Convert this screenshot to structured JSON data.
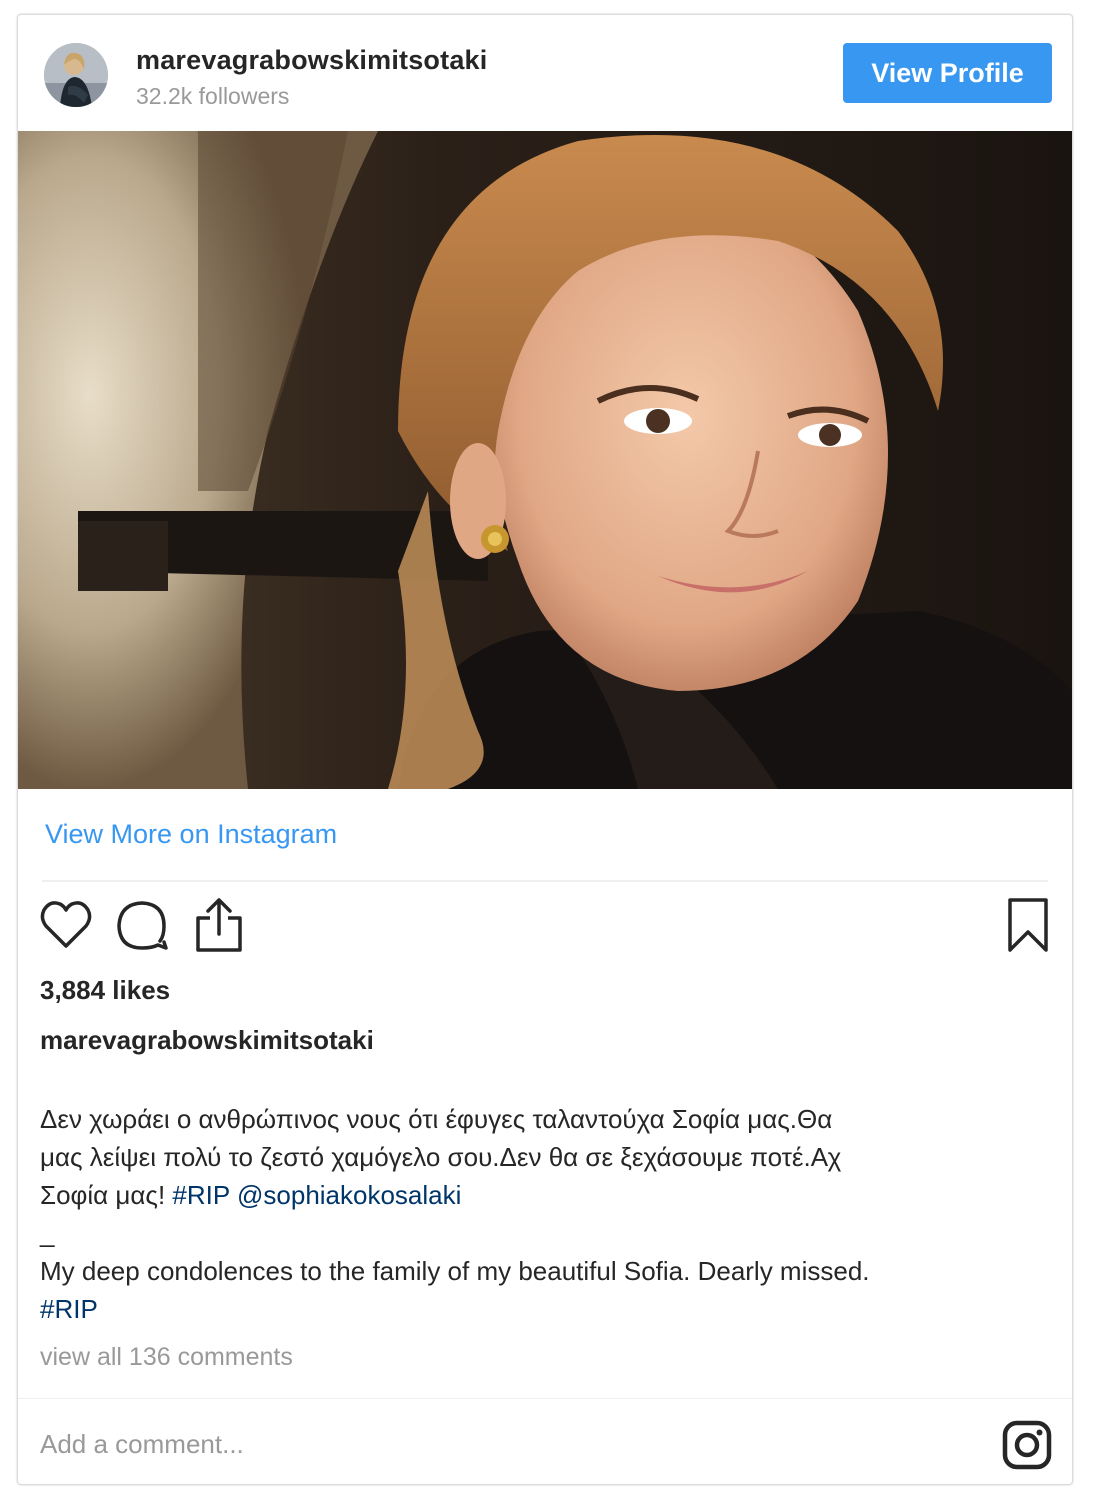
{
  "header": {
    "username": "marevagrabowskimitsotaki",
    "followers": "32.2k followers",
    "view_profile_label": "View Profile"
  },
  "links": {
    "view_more": "View More on Instagram"
  },
  "actions": {
    "icons": [
      "heart-icon",
      "comment-icon",
      "share-icon",
      "bookmark-icon"
    ]
  },
  "post": {
    "likes": "3,884 likes",
    "caption_user": "marevagrabowskimitsotaki",
    "caption_greek_1": "Δεν χωράει ο ανθρώπινος νους ότι έφυγες ταλαντούχα Σοφία μας.Θα",
    "caption_greek_2": "μας λείψει πολύ το ζεστό χαμόγελο σου.Δεν θα σε ξεχάσουμε ποτέ.Αχ",
    "caption_greek_3_prefix": "Σοφία μας! ",
    "hashtag_rip": "#RIP",
    "mention": "@sophiakokosalaki",
    "separator": "_",
    "caption_english": "My deep condolences to the family of my beautiful Sofia. Dearly missed.",
    "hashtag_rip_2": "#RIP",
    "view_comments": "view all 136 comments"
  },
  "comment_box": {
    "placeholder": "Add a comment..."
  },
  "colors": {
    "accent_blue": "#3897f0",
    "hashtag_blue": "#003569",
    "muted_gray": "#999999",
    "text": "#262626"
  }
}
